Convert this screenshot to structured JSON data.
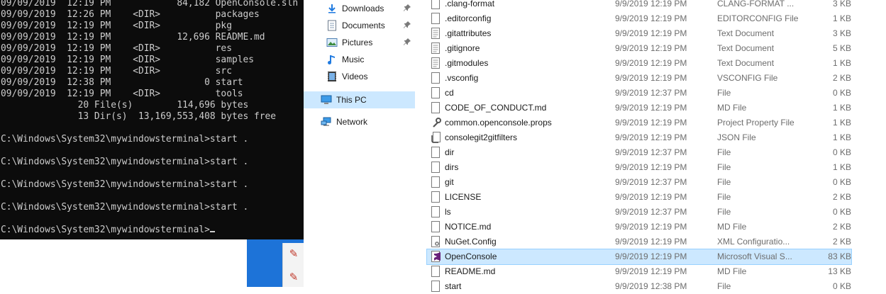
{
  "console": {
    "lines": [
      "09/09/2019  12:19 PM            84,182 OpenConsole.sln",
      "09/09/2019  12:26 PM    <DIR>          packages",
      "09/09/2019  12:19 PM    <DIR>          pkg",
      "09/09/2019  12:19 PM            12,696 README.md",
      "09/09/2019  12:19 PM    <DIR>          res",
      "09/09/2019  12:19 PM    <DIR>          samples",
      "09/09/2019  12:19 PM    <DIR>          src",
      "09/09/2019  12:38 PM                 0 start",
      "09/09/2019  12:19 PM    <DIR>          tools",
      "              20 File(s)        114,696 bytes",
      "              13 Dir(s)  13,169,553,408 bytes free",
      "",
      "C:\\Windows\\System32\\mywindowsterminal>start .",
      "",
      "C:\\Windows\\System32\\mywindowsterminal>start .",
      "",
      "C:\\Windows\\System32\\mywindowsterminal>start .",
      "",
      "C:\\Windows\\System32\\mywindowsterminal>start .",
      "",
      "C:\\Windows\\System32\\mywindowsterminal>"
    ]
  },
  "nav": {
    "items": [
      {
        "label": "Downloads",
        "icon": "download-icon",
        "pinned": true
      },
      {
        "label": "Documents",
        "icon": "documents-icon",
        "pinned": true
      },
      {
        "label": "Pictures",
        "icon": "pictures-icon",
        "pinned": true
      },
      {
        "label": "Music",
        "icon": "music-icon",
        "pinned": false
      },
      {
        "label": "Videos",
        "icon": "videos-icon",
        "pinned": false
      },
      {
        "label": "This PC",
        "icon": "computer-icon",
        "pinned": false,
        "selected": true
      },
      {
        "label": "Network",
        "icon": "network-icon",
        "pinned": false
      }
    ]
  },
  "files": [
    {
      "name": ".clang-format",
      "date": "9/9/2019 12:19 PM",
      "type": "CLANG-FORMAT ...",
      "size": "3 KB",
      "icon": "document-icon"
    },
    {
      "name": ".editorconfig",
      "date": "9/9/2019 12:19 PM",
      "type": "EDITORCONFIG File",
      "size": "1 KB",
      "icon": "document-icon"
    },
    {
      "name": ".gitattributes",
      "date": "9/9/2019 12:19 PM",
      "type": "Text Document",
      "size": "3 KB",
      "icon": "text-document-icon"
    },
    {
      "name": ".gitignore",
      "date": "9/9/2019 12:19 PM",
      "type": "Text Document",
      "size": "5 KB",
      "icon": "text-document-icon"
    },
    {
      "name": ".gitmodules",
      "date": "9/9/2019 12:19 PM",
      "type": "Text Document",
      "size": "1 KB",
      "icon": "text-document-icon"
    },
    {
      "name": ".vsconfig",
      "date": "9/9/2019 12:19 PM",
      "type": "VSCONFIG File",
      "size": "2 KB",
      "icon": "document-icon"
    },
    {
      "name": "cd",
      "date": "9/9/2019 12:37 PM",
      "type": "File",
      "size": "0 KB",
      "icon": "document-icon"
    },
    {
      "name": "CODE_OF_CONDUCT.md",
      "date": "9/9/2019 12:19 PM",
      "type": "MD File",
      "size": "1 KB",
      "icon": "document-icon"
    },
    {
      "name": "common.openconsole.props",
      "date": "9/9/2019 12:19 PM",
      "type": "Project Property File",
      "size": "1 KB",
      "icon": "wrench-icon"
    },
    {
      "name": "consolegit2gitfilters",
      "date": "9/9/2019 12:19 PM",
      "type": "JSON File",
      "size": "1 KB",
      "icon": "json-file-icon"
    },
    {
      "name": "dir",
      "date": "9/9/2019 12:37 PM",
      "type": "File",
      "size": "0 KB",
      "icon": "document-icon"
    },
    {
      "name": "dirs",
      "date": "9/9/2019 12:19 PM",
      "type": "File",
      "size": "1 KB",
      "icon": "document-icon"
    },
    {
      "name": "git",
      "date": "9/9/2019 12:37 PM",
      "type": "File",
      "size": "0 KB",
      "icon": "document-icon"
    },
    {
      "name": "LICENSE",
      "date": "9/9/2019 12:19 PM",
      "type": "File",
      "size": "2 KB",
      "icon": "document-icon"
    },
    {
      "name": "ls",
      "date": "9/9/2019 12:37 PM",
      "type": "File",
      "size": "0 KB",
      "icon": "document-icon"
    },
    {
      "name": "NOTICE.md",
      "date": "9/9/2019 12:19 PM",
      "type": "MD File",
      "size": "2 KB",
      "icon": "document-icon"
    },
    {
      "name": "NuGet.Config",
      "date": "9/9/2019 12:19 PM",
      "type": "XML Configuratio...",
      "size": "2 KB",
      "icon": "xml-config-icon"
    },
    {
      "name": "OpenConsole",
      "date": "9/9/2019 12:19 PM",
      "type": "Microsoft Visual S...",
      "size": "83 KB",
      "icon": "visual-studio-icon",
      "selected": true
    },
    {
      "name": "README.md",
      "date": "9/9/2019 12:19 PM",
      "type": "MD File",
      "size": "13 KB",
      "icon": "document-icon"
    },
    {
      "name": "start",
      "date": "9/9/2019 12:38 PM",
      "type": "File",
      "size": "0 KB",
      "icon": "document-icon"
    }
  ],
  "colors": {
    "console_bg": "#0c0c0c",
    "console_fg": "#cccccc",
    "selection": "#cce8ff",
    "selection_border": "#99d1ff",
    "desktop_blue": "#1d73d8"
  }
}
